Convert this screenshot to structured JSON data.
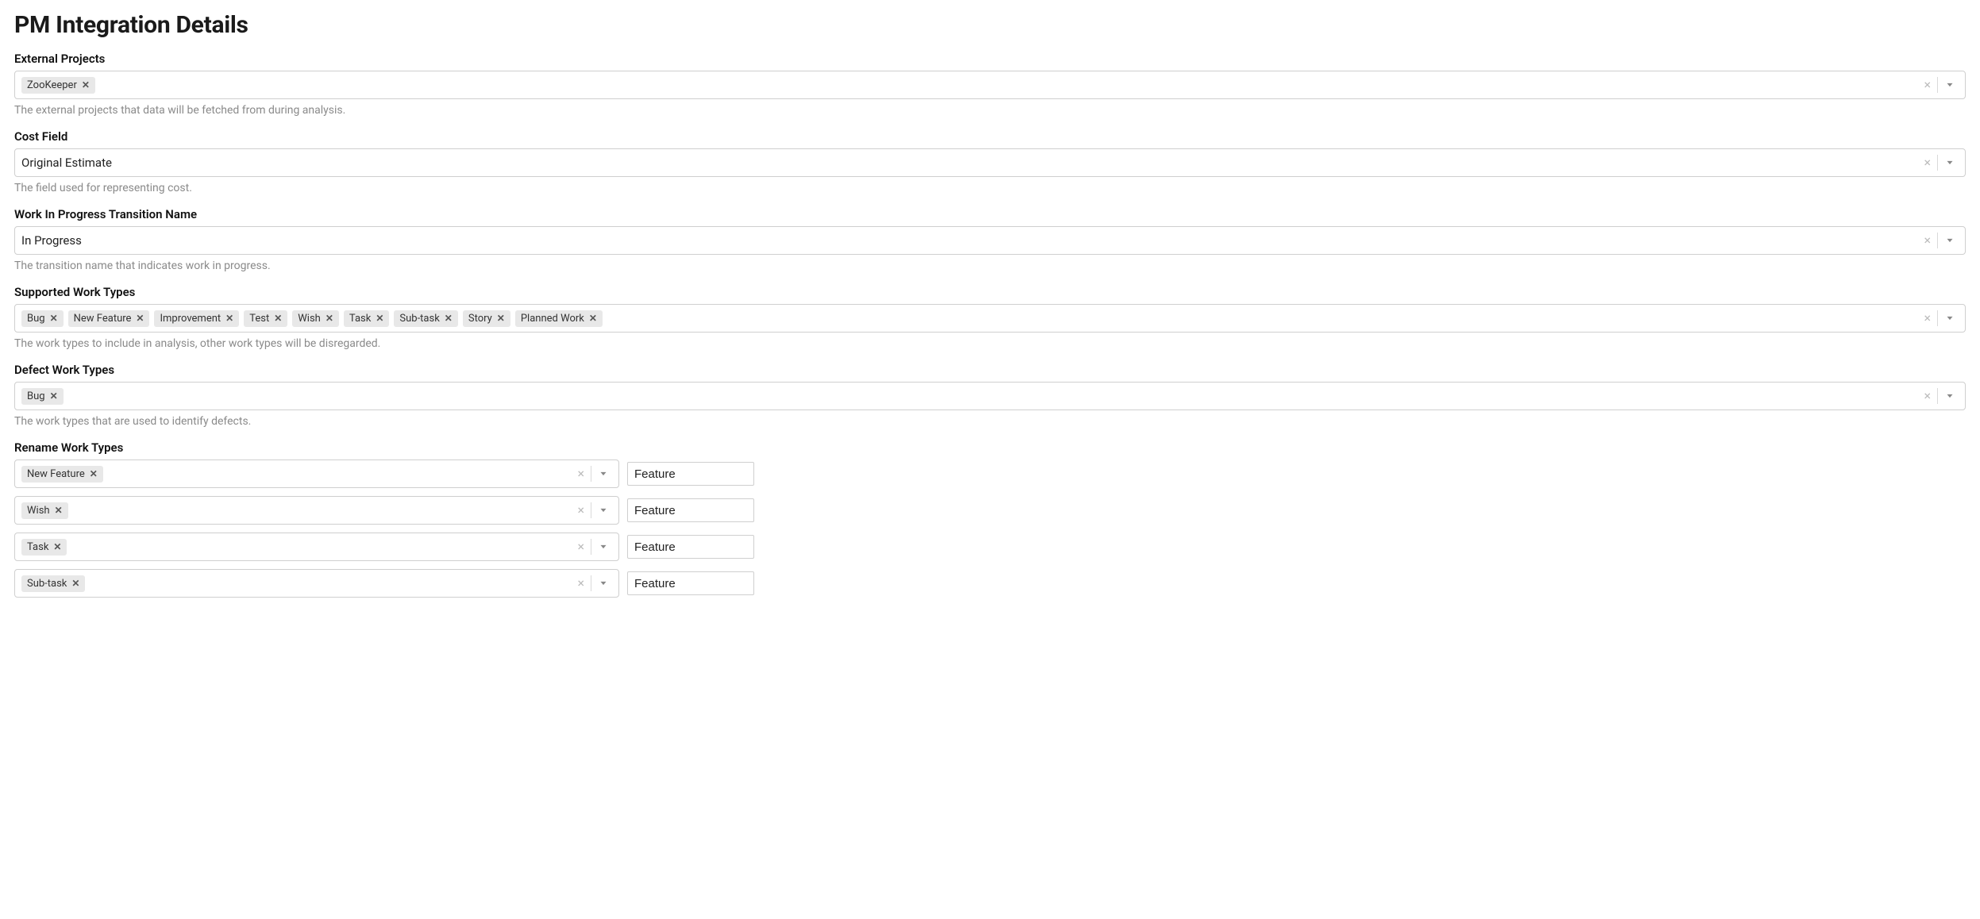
{
  "page_title": "PM Integration Details",
  "fields": {
    "external_projects": {
      "label": "External Projects",
      "tags": [
        "ZooKeeper"
      ],
      "help": "The external projects that data will be fetched from during analysis."
    },
    "cost_field": {
      "label": "Cost Field",
      "value": "Original Estimate",
      "help": "The field used for representing cost."
    },
    "wip_transition": {
      "label": "Work In Progress Transition Name",
      "value": "In Progress",
      "help": "The transition name that indicates work in progress."
    },
    "supported_work_types": {
      "label": "Supported Work Types",
      "tags": [
        "Bug",
        "New Feature",
        "Improvement",
        "Test",
        "Wish",
        "Task",
        "Sub-task",
        "Story",
        "Planned Work"
      ],
      "help": "The work types to include in analysis, other work types will be disregarded."
    },
    "defect_work_types": {
      "label": "Defect Work Types",
      "tags": [
        "Bug"
      ],
      "help": "The work types that are used to identify defects."
    },
    "rename_work_types": {
      "label": "Rename Work Types",
      "rows": [
        {
          "from": "New Feature",
          "to": "Feature"
        },
        {
          "from": "Wish",
          "to": "Feature"
        },
        {
          "from": "Task",
          "to": "Feature"
        },
        {
          "from": "Sub-task",
          "to": "Feature"
        }
      ]
    }
  }
}
